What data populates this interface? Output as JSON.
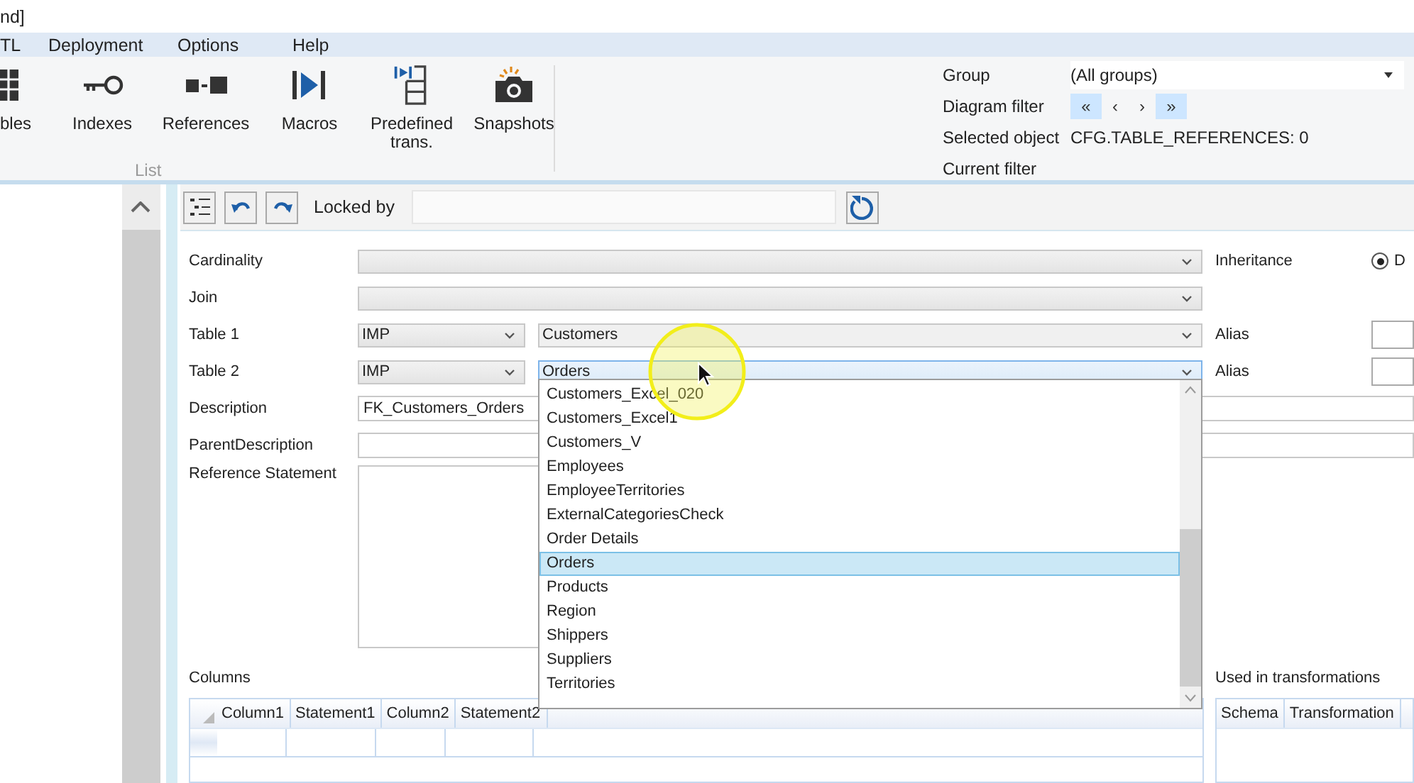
{
  "title_bar": {
    "title": "nd]"
  },
  "menu": [
    {
      "label": "TL"
    },
    {
      "label": "Deployment"
    },
    {
      "label": "Options"
    },
    {
      "label": "Help"
    }
  ],
  "ribbon": {
    "buttons": [
      {
        "label": "bles",
        "kind": "table"
      },
      {
        "label": "Indexes",
        "kind": "key"
      },
      {
        "label": "References",
        "kind": "reference"
      },
      {
        "label": "Macros",
        "kind": "macro"
      },
      {
        "label": "Predefined trans.",
        "kind": "predefined"
      },
      {
        "label": "Snapshots",
        "kind": "camera"
      }
    ],
    "group_label": "List"
  },
  "filter_panel": {
    "group_label": "Group",
    "group_value": "(All groups)",
    "diagram_filter_label": "Diagram filter",
    "nav_buttons": [
      {
        "label": "«",
        "highlighted": true
      },
      {
        "label": "‹",
        "highlighted": false
      },
      {
        "label": "›",
        "highlighted": false
      },
      {
        "label": "»",
        "highlighted": true
      }
    ],
    "selected_object_label": "Selected object",
    "selected_object_value": "CFG.TABLE_REFERENCES: 0",
    "current_filter_label": "Current filter"
  },
  "toolbar": {
    "locked_by_label": "Locked by"
  },
  "form": {
    "cardinality": {
      "label": "Cardinality"
    },
    "join": {
      "label": "Join"
    },
    "inheritance": {
      "label": "Inheritance",
      "option": "D",
      "checked": true
    },
    "table1": {
      "label": "Table 1",
      "schema": "IMP",
      "table": "Customers",
      "alias_label": "Alias",
      "open": false
    },
    "table2": {
      "label": "Table 2",
      "schema": "IMP",
      "table": "Orders",
      "alias_label": "Alias",
      "open": true
    },
    "description": {
      "label": "Description",
      "value": "FK_Customers_Orders"
    },
    "parent_description": {
      "label": "ParentDescription"
    },
    "reference_statement": {
      "label": "Reference Statement"
    },
    "columns": {
      "label": "Columns",
      "headers": [
        "Column1",
        "Statement1",
        "Column2",
        "Statement2"
      ]
    },
    "used_in": {
      "label": "Used in transformations",
      "headers": [
        "Schema",
        "Transformation"
      ]
    }
  },
  "dropdown": {
    "items": [
      {
        "label": "Customers_Excel_020",
        "selected": false
      },
      {
        "label": "Customers_Excel1",
        "selected": false
      },
      {
        "label": "Customers_V",
        "selected": false
      },
      {
        "label": "Employees",
        "selected": false
      },
      {
        "label": "EmployeeTerritories",
        "selected": false
      },
      {
        "label": "ExternalCategoriesCheck",
        "selected": false
      },
      {
        "label": "Order Details",
        "selected": false
      },
      {
        "label": "Orders",
        "selected": true
      },
      {
        "label": "Products",
        "selected": false
      },
      {
        "label": "Region",
        "selected": false
      },
      {
        "label": "Shippers",
        "selected": false
      },
      {
        "label": "Suppliers",
        "selected": false
      },
      {
        "label": "Territories",
        "selected": false
      }
    ]
  }
}
